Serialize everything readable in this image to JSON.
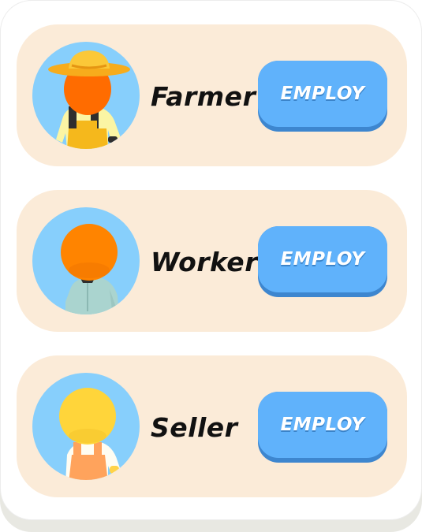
{
  "roles": [
    {
      "name": "Farmer",
      "button_label": "EMPLOY",
      "icon": "farmer-character-icon"
    },
    {
      "name": "Worker",
      "button_label": "EMPLOY",
      "icon": "worker-character-icon"
    },
    {
      "name": "Seller",
      "button_label": "EMPLOY",
      "icon": "seller-character-icon"
    }
  ],
  "colors": {
    "panel": "#ffffff",
    "card": "#fbebd8",
    "avatar_bg": "#87cffc",
    "button": "#60b2fb",
    "button_shadow": "#3d86cf",
    "text": "#111111"
  }
}
